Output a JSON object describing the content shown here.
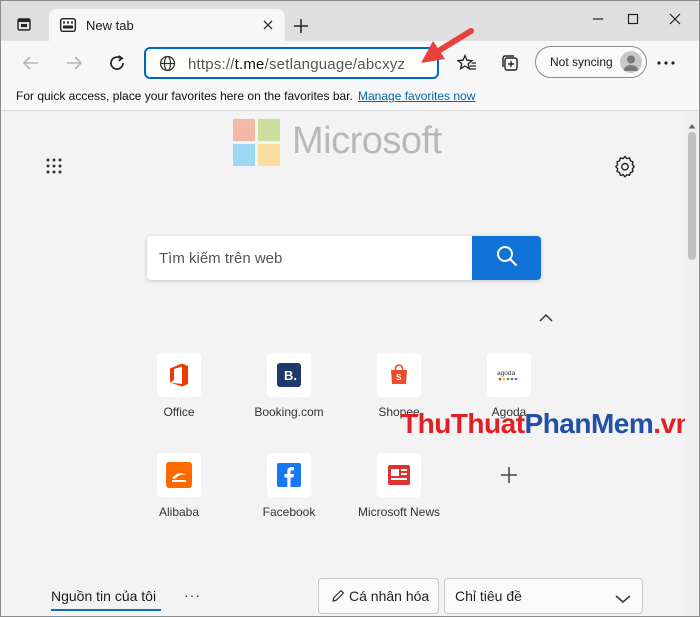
{
  "browser": {
    "tab_title": "New tab",
    "address_host": "t.me",
    "address_prefix": "https://",
    "address_path": "/setlanguage/abcxyz",
    "sync_label": "Not syncing"
  },
  "favorites_bar": {
    "message": "For quick access, place your favorites here on the favorites bar.",
    "manage_link": "Manage favorites now"
  },
  "newtab": {
    "brand_text": "Microsoft",
    "search_placeholder": "Tìm kiếm trên web",
    "tiles": [
      {
        "label": "Office",
        "icon": "office-icon"
      },
      {
        "label": "Booking.com",
        "icon": "booking-icon"
      },
      {
        "label": "Shopee",
        "icon": "shopee-icon"
      },
      {
        "label": "Agoda",
        "icon": "agoda-icon"
      },
      {
        "label": "Alibaba",
        "icon": "alibaba-icon"
      },
      {
        "label": "Facebook",
        "icon": "facebook-icon"
      },
      {
        "label": "Microsoft News",
        "icon": "microsoft-news-icon"
      }
    ],
    "watermark": {
      "part1": "ThuThuat",
      "part2": "PhanMem",
      "part3": ".vn"
    },
    "feed_tab": "Nguồn tin của tôi",
    "personalize_button": "Cá nhân hóa",
    "layout_select": "Chỉ tiêu đề"
  },
  "colors": {
    "accent": "#0067c0",
    "search_button": "#0f72d9",
    "arrow": "#e8413b"
  }
}
